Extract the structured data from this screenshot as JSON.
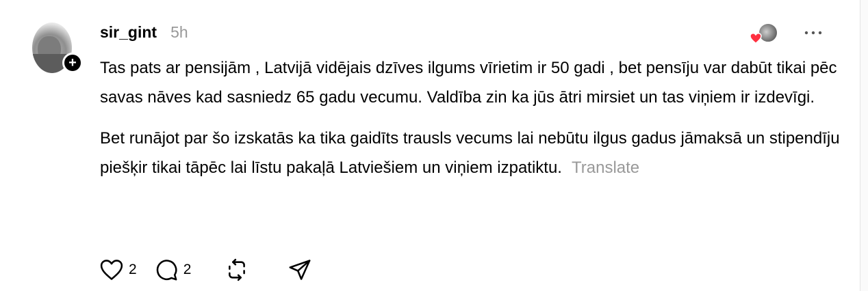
{
  "post": {
    "username": "sir_gint",
    "time": "5h",
    "paragraph_1": "Tas pats ar pensijām , Latvijā vidējais dzīves ilgums vīrietim ir 50 gadi , bet pensīju var dabūt tikai pēc savas nāves kad sasniedz 65 gadu vecumu. Valdība zin ka jūs ātri mirsiet un tas viņiem ir izdevīgi.",
    "paragraph_2": "Bet runājot par šo izskatās ka tika gaidīts trausls vecums lai nebūtu ilgus gadus jāmaksā un stipendīju piešķir tikai tāpēc lai līstu pakaļā Latviešiem un viņiem izpatiktu.",
    "translate_label": "Translate"
  },
  "actions": {
    "like_count": "2",
    "reply_count": "2"
  },
  "icons": {
    "follow": "plus-icon",
    "like": "heart-icon",
    "reply": "comment-icon",
    "repost": "repost-icon",
    "share": "send-icon",
    "more": "more-icon"
  },
  "colors": {
    "text": "#000000",
    "muted": "#999999",
    "heart": "#ff3040"
  }
}
